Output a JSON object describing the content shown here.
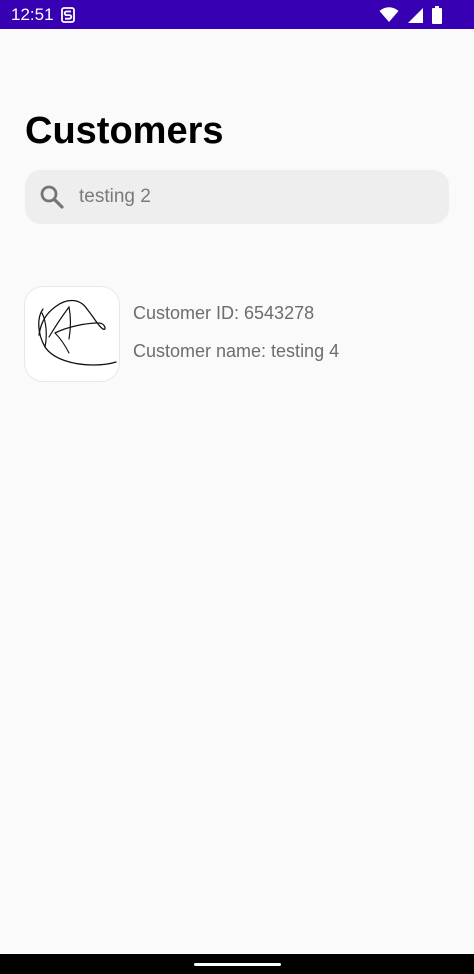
{
  "status_bar": {
    "time": "12:51",
    "background_color": "#3700b3",
    "icons": [
      "s-notification-icon",
      "wifi-icon",
      "signal-icon",
      "battery-icon"
    ]
  },
  "page": {
    "title": "Customers"
  },
  "search": {
    "value": "testing 2",
    "icon": "search-icon"
  },
  "customers": [
    {
      "id_text": "Customer ID: 6543278",
      "name_text": "Customer name: testing 4",
      "thumbnail": "signature-image"
    }
  ]
}
